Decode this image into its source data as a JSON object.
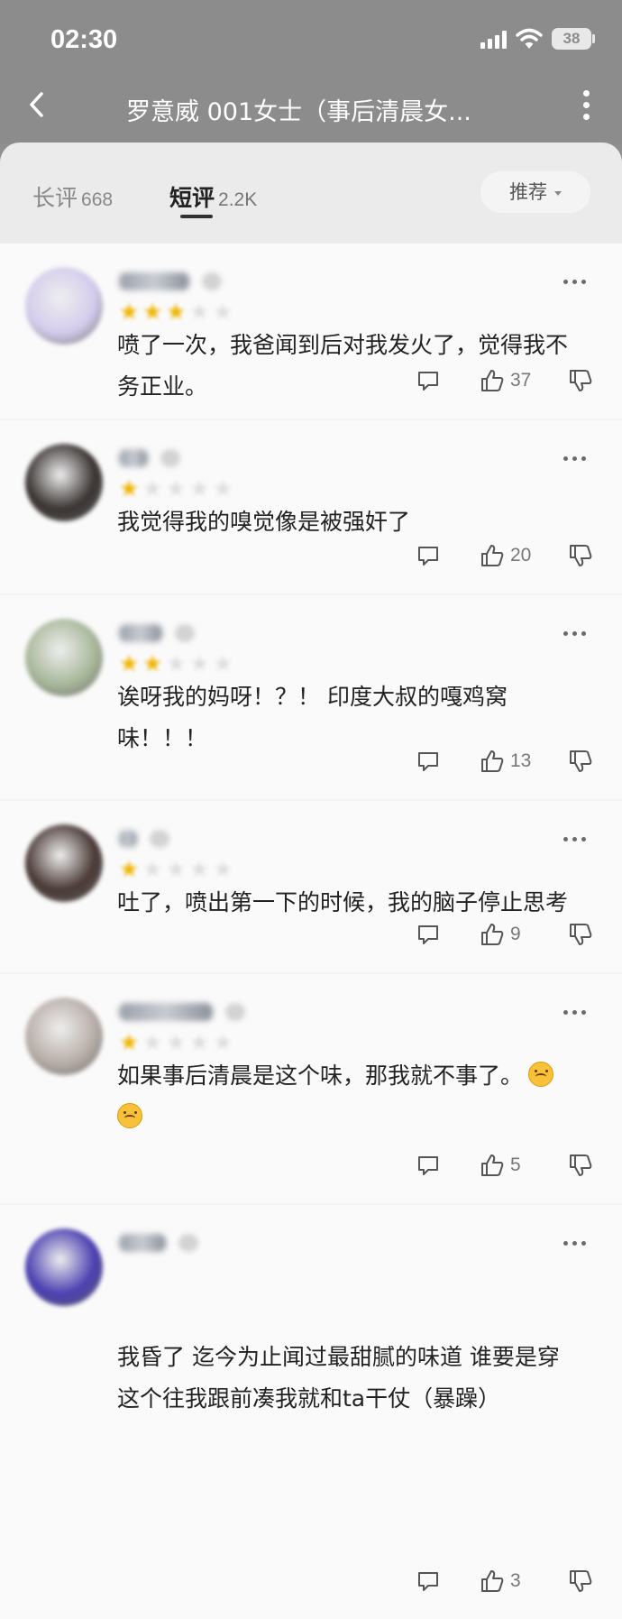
{
  "status_bar": {
    "time": "02:30",
    "battery": "38"
  },
  "nav": {
    "title": "罗意威 001女士（事后清晨女..."
  },
  "tabs": [
    {
      "label": "长评",
      "count": "668"
    },
    {
      "label": "短评",
      "count": "2.2K"
    }
  ],
  "sort": {
    "label": "推荐"
  },
  "reviews": [
    {
      "stars": 3,
      "text_lines": [
        "喷了一次，我爸闻到后对我发火了，觉得我不",
        "务正业。"
      ],
      "likes": "37",
      "avatar_color": "#d4ccec"
    },
    {
      "stars": 1,
      "text_lines": [
        "我觉得我的嗅觉像是被强奸了"
      ],
      "likes": "20",
      "avatar_color": "#3a3432"
    },
    {
      "stars": 2,
      "text_lines": [
        "诶呀我的妈呀！？！ 印度大叔的嘎鸡窝",
        "味！！！"
      ],
      "likes": "13",
      "avatar_color": "#a8b89a"
    },
    {
      "stars": 1,
      "text_lines": [
        "吐了，喷出第一下的时候，我的脑子停止思考"
      ],
      "likes": "9",
      "avatar_color": "#4a3a36"
    },
    {
      "stars": 1,
      "text_lines": [
        "如果事后清晨是这个味，那我就不事了。",
        ""
      ],
      "likes": "5",
      "avatar_color": "#b8aea8"
    },
    {
      "stars": 0,
      "text_lines": [
        "我昏了 迄今为止闻过最甜腻的味道 谁要是穿",
        "这个往我跟前凑我就和ta干仗（暴躁）"
      ],
      "likes": "3",
      "avatar_color": "#4a3fb0"
    }
  ]
}
